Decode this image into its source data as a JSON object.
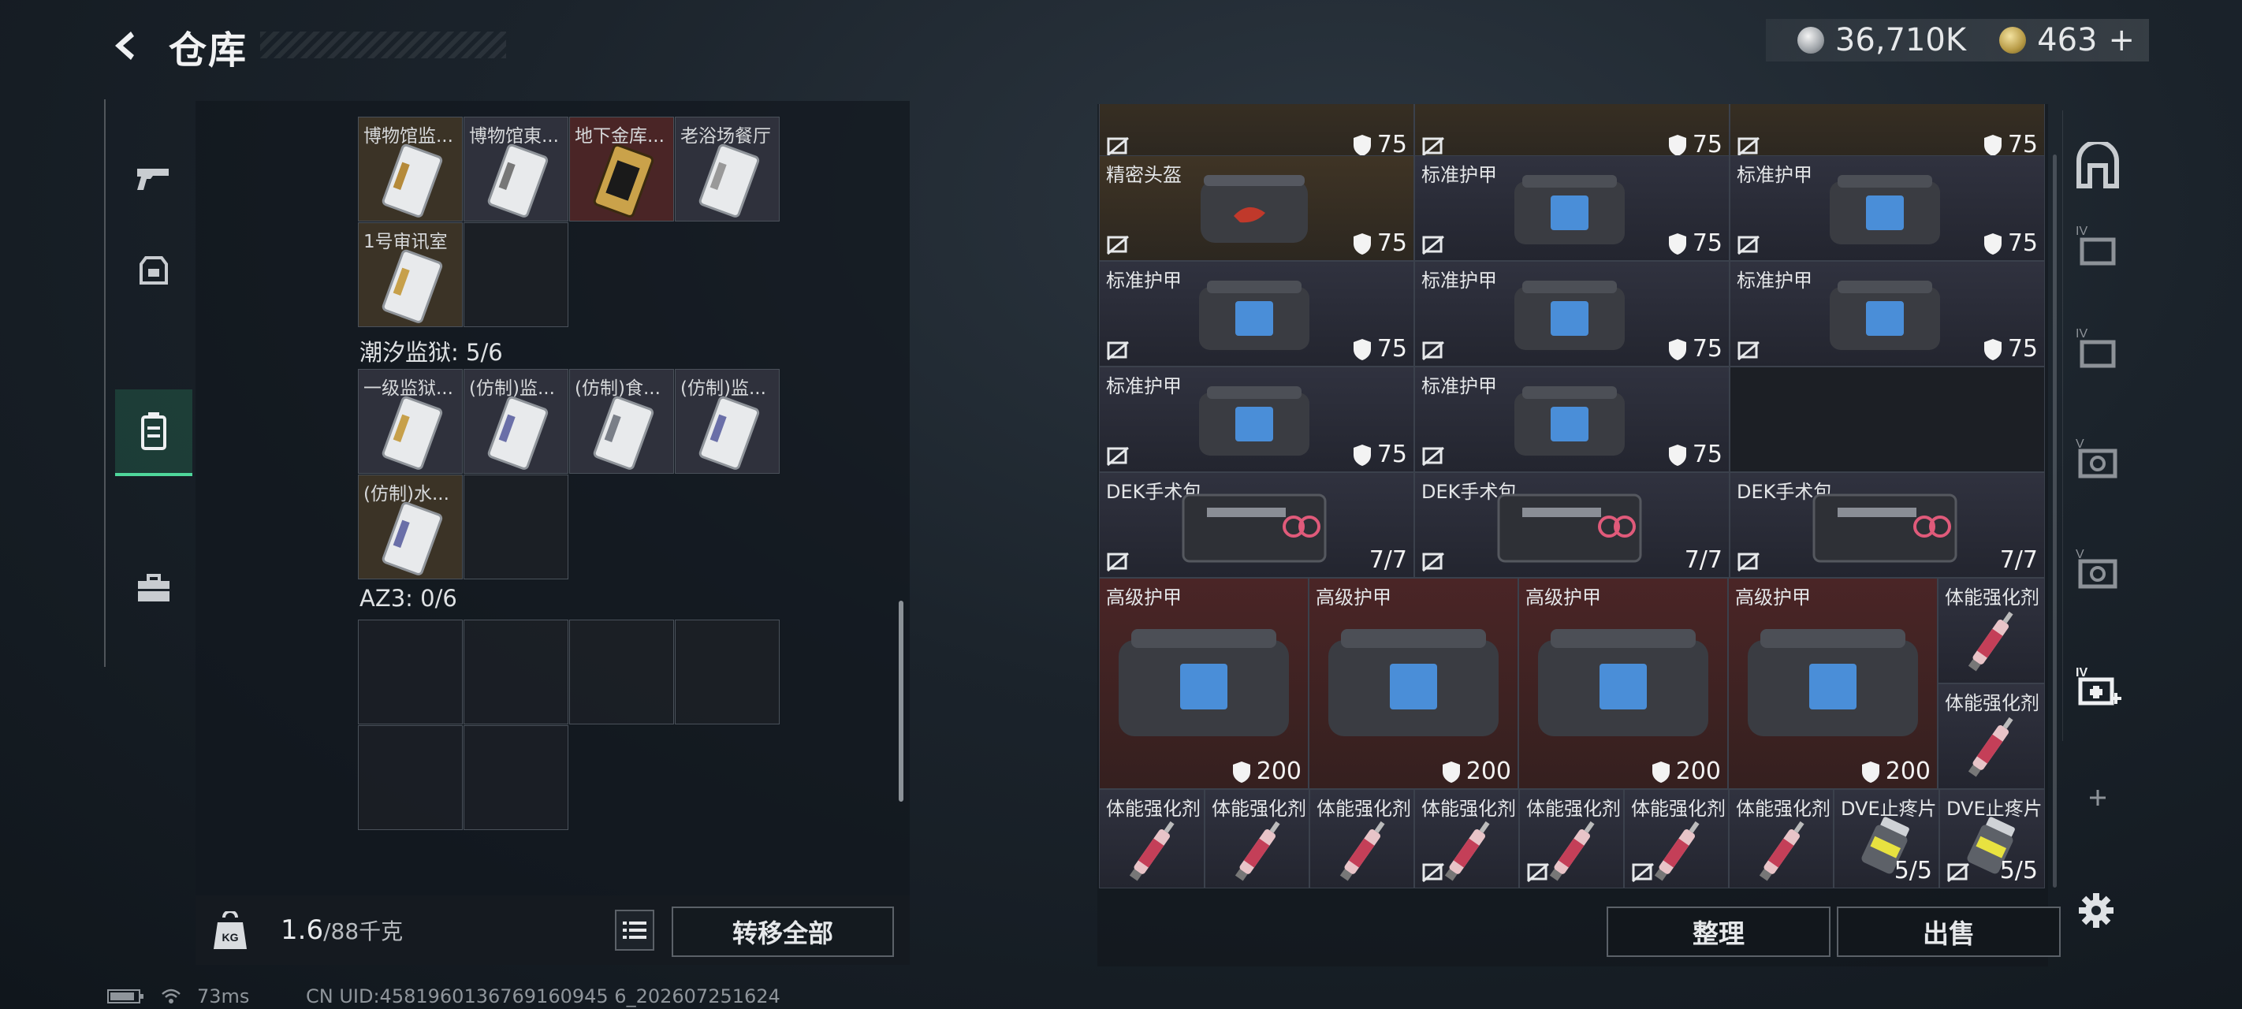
{
  "header": {
    "title": "仓库",
    "currency_silver": "36,710K",
    "currency_gold": "463",
    "gold_plus": "+"
  },
  "left": {
    "row1": [
      "博物馆监...",
      "博物馆東...",
      "地下金库...",
      "老浴场餐厅"
    ],
    "row2": [
      "1号审讯室"
    ],
    "section_prison": "潮汐监狱: 5/6",
    "row3": [
      "一级监狱...",
      "(仿制)监...",
      "(仿制)食...",
      "(仿制)监..."
    ],
    "row4": [
      "(仿制)水..."
    ],
    "section_az3": "AZ3: 0/6",
    "weight_value": "1.6",
    "weight_max": "/88千克",
    "transfer_label": "转移全部"
  },
  "right": {
    "row0": [
      {
        "value": "75"
      },
      {
        "value": "75"
      },
      {
        "value": "75"
      }
    ],
    "row1": [
      {
        "name": "精密头盔",
        "value": "75"
      },
      {
        "name": "标准护甲",
        "value": "75"
      },
      {
        "name": "标准护甲",
        "value": "75"
      }
    ],
    "row2": [
      {
        "name": "标准护甲",
        "value": "75"
      },
      {
        "name": "标准护甲",
        "value": "75"
      },
      {
        "name": "标准护甲",
        "value": "75"
      }
    ],
    "row3": [
      {
        "name": "标准护甲",
        "value": "75"
      },
      {
        "name": "标准护甲",
        "value": "75"
      }
    ],
    "row4": [
      {
        "name": "DEK手术包",
        "value": "7/7"
      },
      {
        "name": "DEK手术包",
        "value": "7/7"
      },
      {
        "name": "DEK手术包",
        "value": "7/7"
      }
    ],
    "row5": [
      {
        "name": "高级护甲",
        "value": "200"
      },
      {
        "name": "高级护甲",
        "value": "200"
      },
      {
        "name": "高级护甲",
        "value": "200"
      },
      {
        "name": "高级护甲",
        "value": "200"
      }
    ],
    "row5_side": [
      {
        "name": "体能强化剂"
      },
      {
        "name": "体能强化剂"
      }
    ],
    "row6": [
      {
        "name": "体能强化剂"
      },
      {
        "name": "体能强化剂"
      },
      {
        "name": "体能强化剂"
      },
      {
        "name": "体能强化剂"
      },
      {
        "name": "体能强化剂"
      },
      {
        "name": "体能强化剂"
      },
      {
        "name": "体能强化剂"
      },
      {
        "name": "DVE止疼片",
        "value": "5/5"
      },
      {
        "name": "DVE止疼片",
        "value": "5/5"
      }
    ],
    "sort_label": "整理",
    "sell_label": "出售"
  },
  "status": {
    "ping": "73ms",
    "uid": "CN UID:4581960136769160945 6_202607251624"
  },
  "colors": {
    "accent": "#4fd79b",
    "brown_tile": "#3f3425",
    "red_tile": "#4a2526",
    "dark_tile": "#30323f"
  }
}
